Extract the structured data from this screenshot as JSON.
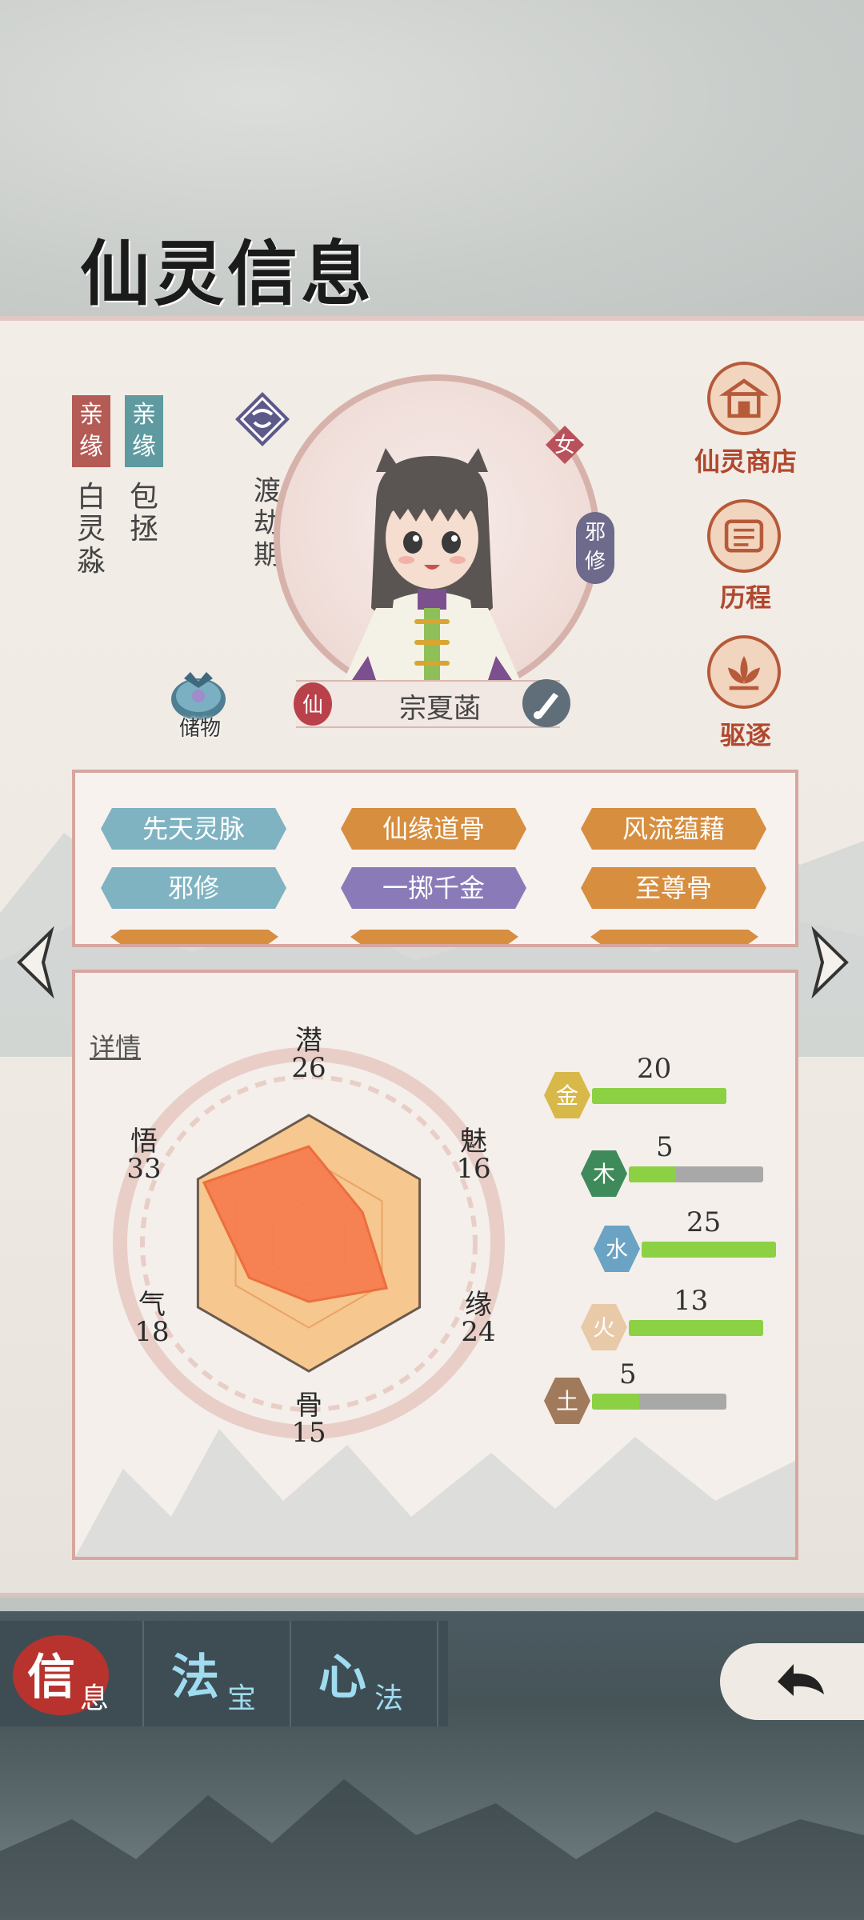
{
  "page": {
    "title": "仙灵信息"
  },
  "relations": [
    {
      "tag": "亲缘",
      "name": "白灵淼",
      "color": "#b45b55"
    },
    {
      "tag": "亲缘",
      "name": "包拯",
      "color": "#5e9aa0"
    }
  ],
  "character": {
    "realm": "渡劫期",
    "gender": "女",
    "sect_tag": "邪修",
    "race_badge": "仙",
    "name": "宗夏菡"
  },
  "storage": {
    "label": "储物"
  },
  "side_menu": [
    {
      "label": "仙灵商店",
      "icon": "shop-icon"
    },
    {
      "label": "历程",
      "icon": "scroll-icon"
    },
    {
      "label": "驱逐",
      "icon": "lotus-icon"
    }
  ],
  "traits": [
    {
      "label": "先天灵脉",
      "color": "blue"
    },
    {
      "label": "仙缘道骨",
      "color": "orange"
    },
    {
      "label": "风流蕴藉",
      "color": "orange"
    },
    {
      "label": "邪修",
      "color": "blue"
    },
    {
      "label": "一掷千金",
      "color": "purple"
    },
    {
      "label": "至尊骨",
      "color": "orange"
    }
  ],
  "stats": {
    "detail_label": "详情",
    "radar": [
      {
        "label": "潜",
        "value": 26
      },
      {
        "label": "魅",
        "value": 16
      },
      {
        "label": "缘",
        "value": 24
      },
      {
        "label": "骨",
        "value": 15
      },
      {
        "label": "气",
        "value": 18
      },
      {
        "label": "悟",
        "value": 33
      }
    ],
    "elements": [
      {
        "glyph": "金",
        "value": 20,
        "fill": 1.0,
        "color": "#d9b84a"
      },
      {
        "glyph": "木",
        "value": 5,
        "fill": 0.35,
        "color": "#3e8a5a"
      },
      {
        "glyph": "水",
        "value": 25,
        "fill": 1.0,
        "color": "#6aa3c4"
      },
      {
        "glyph": "火",
        "value": 13,
        "fill": 1.0,
        "color": "#e8c9a8"
      },
      {
        "glyph": "土",
        "value": 5,
        "fill": 0.35,
        "color": "#a07a5a"
      }
    ]
  },
  "tabs": [
    {
      "big": "信",
      "small": "息",
      "active": true
    },
    {
      "big": "法",
      "small": "宝",
      "active": false
    },
    {
      "big": "心",
      "small": "法",
      "active": false
    }
  ]
}
